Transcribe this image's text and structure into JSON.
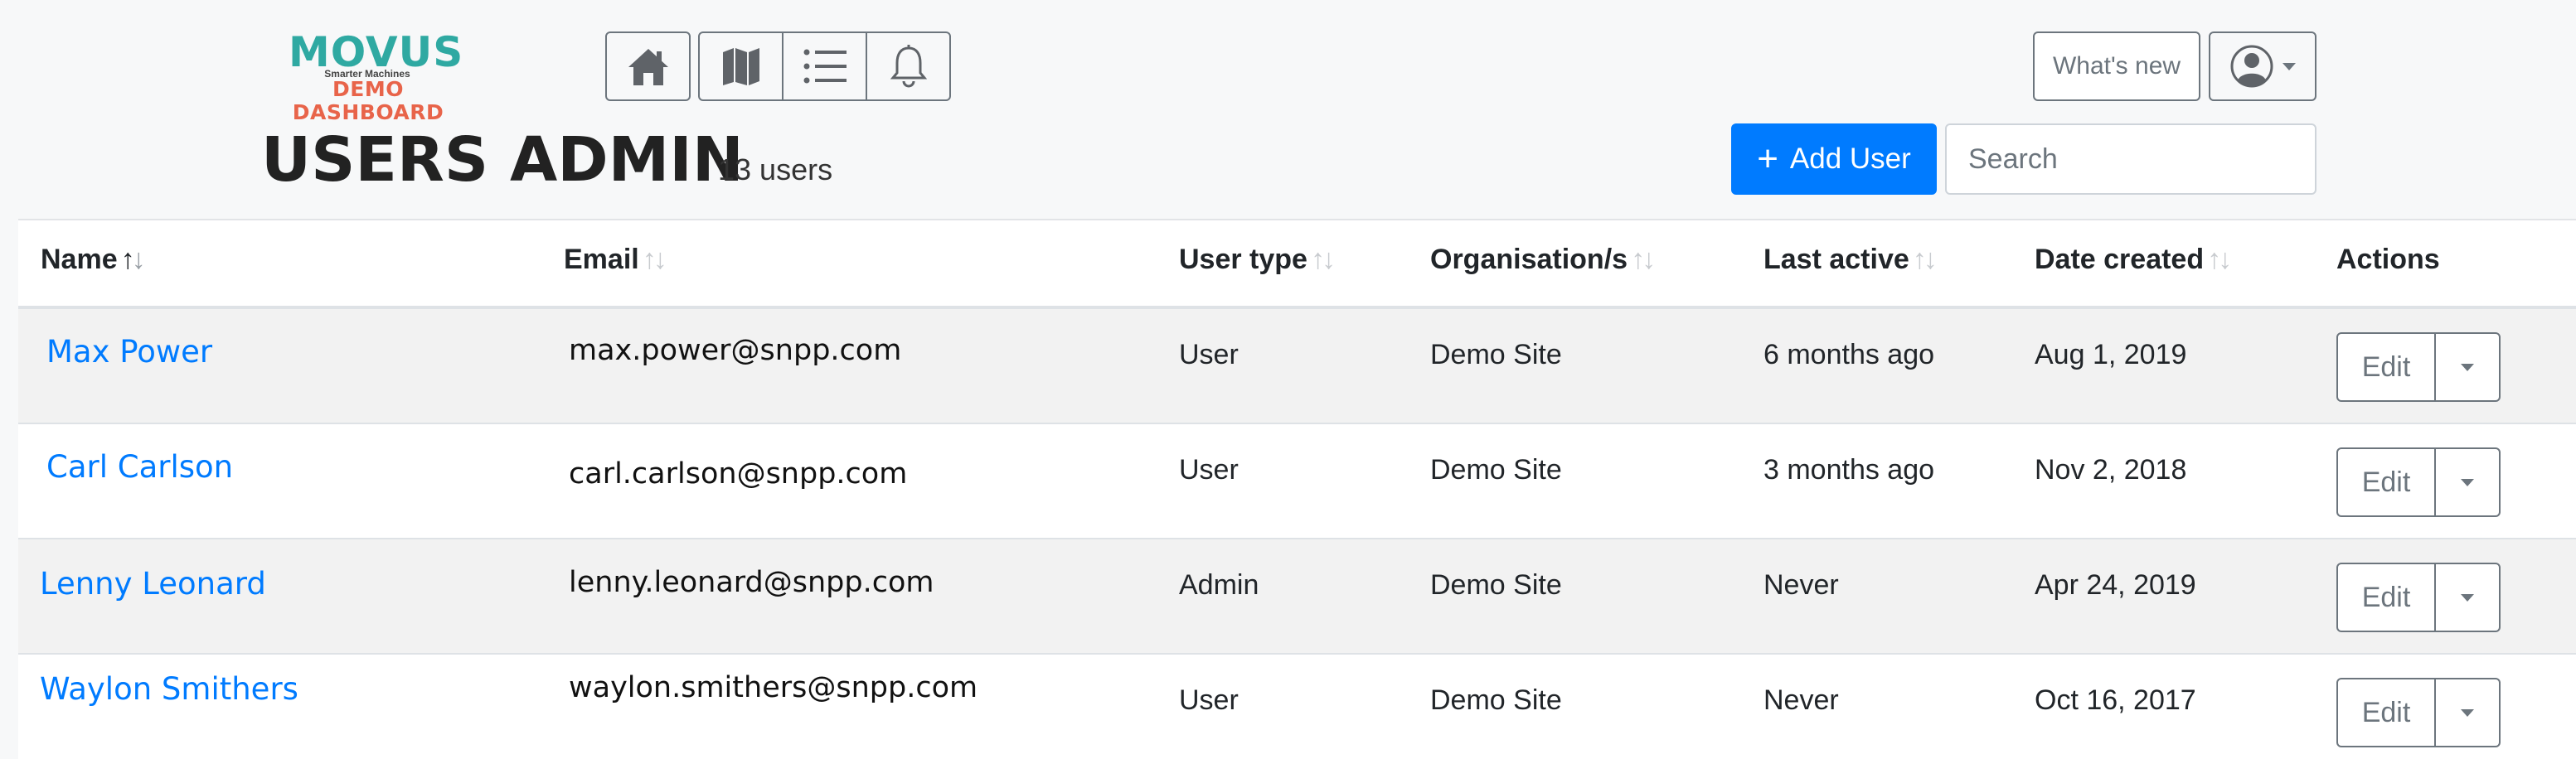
{
  "brand": {
    "name": "MOVUS",
    "tagline": "Smarter Machines",
    "subtitle": "DEMO DASHBOARD"
  },
  "nav": {
    "icons": [
      "home-icon",
      "map-icon",
      "list-icon",
      "bell-icon"
    ]
  },
  "header": {
    "whats_new_label": "What's new",
    "user_menu_icon": "user-circle-icon"
  },
  "page": {
    "title": "USERS ADMIN",
    "count": "13 users"
  },
  "toolbar": {
    "add_user_label": "Add User",
    "search_placeholder": "Search"
  },
  "colors": {
    "accent": "#007bff",
    "brand_teal": "#2fa9a2",
    "brand_orange": "#e8644a"
  },
  "table": {
    "columns": [
      "Name",
      "Email",
      "User type",
      "Organisation/s",
      "Last active",
      "Date created",
      "Actions"
    ],
    "sorted_column": "Name",
    "rows": [
      {
        "name": "Max Power",
        "email": "max.power@snpp.com",
        "user_type": "User",
        "organisation": "Demo Site",
        "last_active": "6 months ago",
        "date_created": "Aug 1, 2019",
        "action": "Edit"
      },
      {
        "name": "Carl Carlson",
        "email": "carl.carlson@snpp.com",
        "user_type": "User",
        "organisation": "Demo Site",
        "last_active": "3 months ago",
        "date_created": "Nov 2, 2018",
        "action": "Edit"
      },
      {
        "name": "Lenny Leonard",
        "email": "lenny.leonard@snpp.com",
        "user_type": "Admin",
        "organisation": "Demo Site",
        "last_active": "Never",
        "date_created": "Apr 24, 2019",
        "action": "Edit"
      },
      {
        "name": "Waylon Smithers",
        "email": "waylon.smithers@snpp.com",
        "user_type": "User",
        "organisation": "Demo Site",
        "last_active": "Never",
        "date_created": "Oct 16, 2017",
        "action": "Edit"
      }
    ]
  }
}
